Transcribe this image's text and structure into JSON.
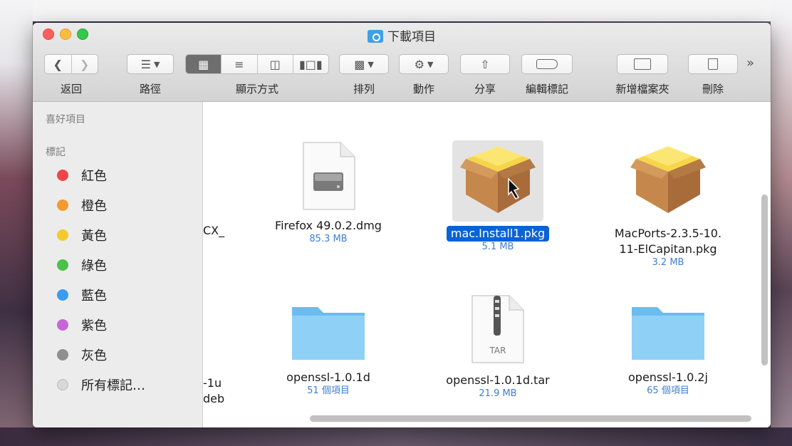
{
  "window": {
    "title": "下載項目"
  },
  "toolbar": {
    "back_label": "返回",
    "path_label": "路徑",
    "view_label": "顯示方式",
    "arrange_label": "排列",
    "action_label": "動作",
    "share_label": "分享",
    "tags_label": "編輯標記",
    "new_folder_label": "新增檔案夾",
    "delete_label": "刪除",
    "overflow": "»"
  },
  "sidebar": {
    "favorites_header": "喜好項目",
    "tags_header": "標記",
    "tags": [
      {
        "label": "紅色",
        "color": "#f0444a"
      },
      {
        "label": "橙色",
        "color": "#f59a2e"
      },
      {
        "label": "黃色",
        "color": "#f6c92b"
      },
      {
        "label": "綠色",
        "color": "#4cc14a"
      },
      {
        "label": "藍色",
        "color": "#3a9cf0"
      },
      {
        "label": "紫色",
        "color": "#c566d6"
      },
      {
        "label": "灰色",
        "color": "#8f8f8f"
      },
      {
        "label": "所有標記…",
        "color": "#d8d8d8"
      }
    ]
  },
  "files": [
    {
      "name": "CX_",
      "sub": "",
      "icon": "partial"
    },
    {
      "name": "Firefox 49.0.2.dmg",
      "sub": "85.3 MB",
      "icon": "dmg-icon"
    },
    {
      "name": "mac.Install1.pkg",
      "sub": "5.1 MB",
      "icon": "package-icon",
      "selected": true
    },
    {
      "name": "MacPorts-2.3.5-10.",
      "name2": "11-ElCapitan.pkg",
      "sub": "3.2 MB",
      "icon": "package-icon"
    },
    {
      "name": "-1u",
      "name2": "deb",
      "sub": "",
      "icon": "partial"
    },
    {
      "name": "openssl-1.0.1d",
      "sub": "51 個項目",
      "icon": "folder-icon"
    },
    {
      "name": "openssl-1.0.1d.tar",
      "sub": "21.9 MB",
      "icon": "tar-icon",
      "icon_text": "TAR"
    },
    {
      "name": "openssl-1.0.2j",
      "sub": "65 個項目",
      "icon": "folder-icon"
    }
  ]
}
